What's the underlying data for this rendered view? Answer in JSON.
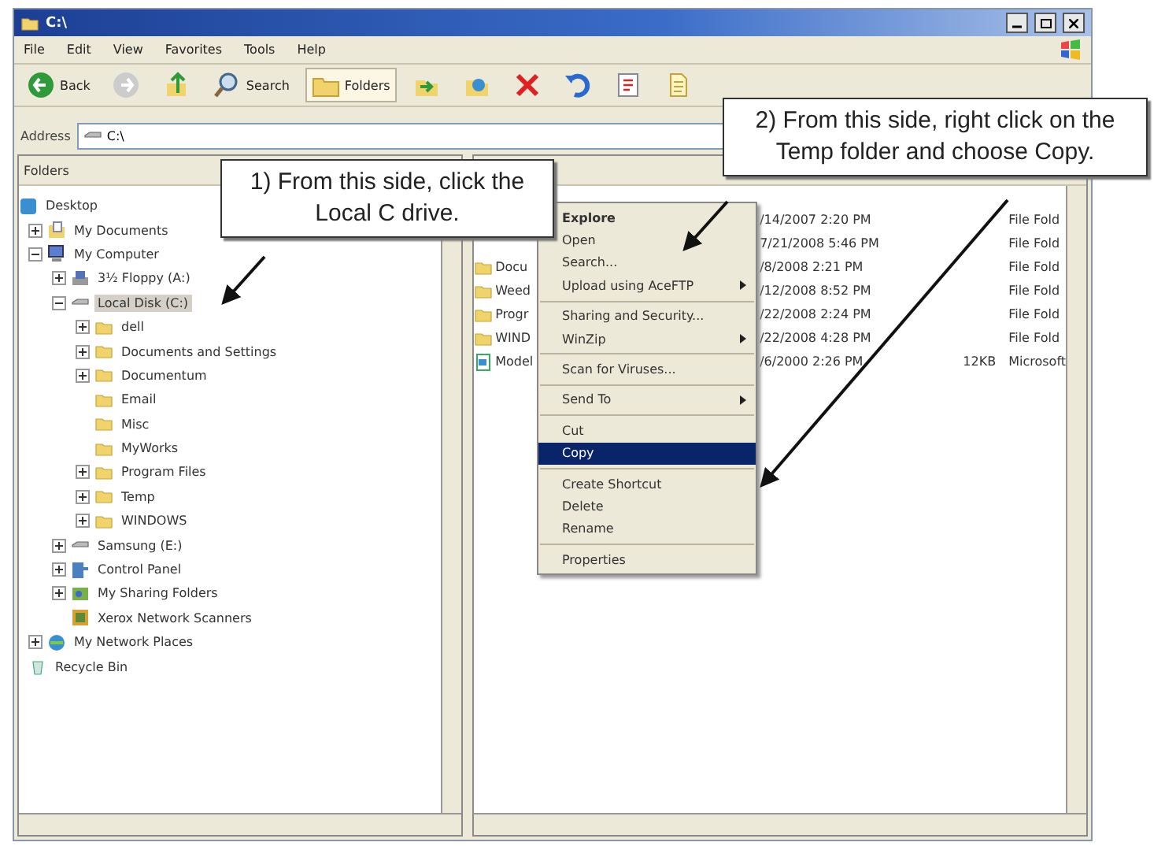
{
  "window": {
    "title": "C:\\"
  },
  "menu_bar": [
    "File",
    "Edit",
    "View",
    "Favorites",
    "Tools",
    "Help"
  ],
  "toolbar": [
    {
      "kind": "back",
      "label": "Back",
      "selected": false
    },
    {
      "kind": "forward",
      "selected": false
    },
    {
      "kind": "up",
      "selected": false
    },
    {
      "kind": "search",
      "label": "Search",
      "selected": false
    },
    {
      "kind": "folders",
      "label": "Folders",
      "selected": true
    },
    {
      "kind": "move",
      "selected": false
    },
    {
      "kind": "copy",
      "selected": false
    },
    {
      "kind": "delete",
      "selected": false
    },
    {
      "kind": "undo",
      "selected": false
    },
    {
      "kind": "properties",
      "selected": false
    },
    {
      "kind": "notes",
      "selected": false
    }
  ],
  "address": {
    "label": "Address",
    "value": "C:\\"
  },
  "folders_pane": {
    "title": "Folders",
    "tree": [
      {
        "label": "Desktop",
        "kind": "desktop",
        "selected": false,
        "children": [
          {
            "label": "My Documents",
            "kind": "documents",
            "expanded": false,
            "selected": false
          },
          {
            "label": "My Computer",
            "kind": "computer",
            "expanded": true,
            "selected": false,
            "children": [
              {
                "label": "3½ Floppy (A:)",
                "kind": "floppy",
                "expanded": false,
                "selected": false
              },
              {
                "label": "Local Disk (C:)",
                "kind": "drive",
                "expanded": true,
                "selected": true,
                "children": [
                  {
                    "label": "dell",
                    "kind": "folder",
                    "expanded": false,
                    "selected": false
                  },
                  {
                    "label": "Documents and Settings",
                    "kind": "folder",
                    "expanded": false,
                    "selected": false
                  },
                  {
                    "label": "Documentum",
                    "kind": "folder",
                    "expanded": false,
                    "selected": false
                  },
                  {
                    "label": "Email",
                    "kind": "folder",
                    "selected": false
                  },
                  {
                    "label": "Misc",
                    "kind": "folder",
                    "selected": false
                  },
                  {
                    "label": "MyWorks",
                    "kind": "folder",
                    "selected": false
                  },
                  {
                    "label": "Program Files",
                    "kind": "folder",
                    "expanded": false,
                    "selected": false
                  },
                  {
                    "label": "Temp",
                    "kind": "folder",
                    "expanded": false,
                    "selected": false
                  },
                  {
                    "label": "WINDOWS",
                    "kind": "folder",
                    "expanded": false,
                    "selected": false
                  }
                ]
              },
              {
                "label": "Samsung (E:)",
                "kind": "drive",
                "expanded": false,
                "selected": false
              },
              {
                "label": "Control Panel",
                "kind": "control",
                "expanded": false,
                "selected": false
              },
              {
                "label": "My Sharing Folders",
                "kind": "sharing",
                "expanded": false,
                "selected": false
              },
              {
                "label": "Xerox Network Scanners",
                "kind": "scanner",
                "selected": false
              }
            ]
          },
          {
            "label": "My Network Places",
            "kind": "network",
            "expanded": false,
            "selected": false
          },
          {
            "label": "Recycle Bin",
            "kind": "recycle",
            "selected": false
          }
        ]
      }
    ]
  },
  "file_list": {
    "rows": [
      {
        "date": "/14/2007 2:20 PM",
        "type": "File Fold"
      },
      {
        "date": "7/21/2008 5:46 PM",
        "type": "File Fold"
      },
      {
        "kind": "folder",
        "name": "Docu",
        "date": "/8/2008 2:21 PM",
        "type": "File Fold"
      },
      {
        "kind": "folder",
        "name": "Weed",
        "date": "/12/2008 8:52 PM",
        "type": "File Fold"
      },
      {
        "kind": "folder",
        "name": "Progr",
        "date": "/22/2008 2:24 PM",
        "type": "File Fold"
      },
      {
        "kind": "folder",
        "name": "WIND",
        "date": "/22/2008 4:28 PM",
        "type": "File Fold"
      },
      {
        "kind": "document",
        "name": "Model",
        "date": "/6/2000 2:26 PM",
        "size": "12KB",
        "type": "Microsoft"
      }
    ]
  },
  "context_menu": [
    {
      "kind": "item",
      "label": "Explore",
      "bold": true,
      "selected": false
    },
    {
      "kind": "item",
      "label": "Open",
      "selected": false
    },
    {
      "kind": "item",
      "label": "Search...",
      "selected": false
    },
    {
      "kind": "submenu",
      "label": "Upload using AceFTP",
      "selected": false
    },
    {
      "kind": "separator"
    },
    {
      "kind": "item",
      "label": "Sharing and Security...",
      "selected": false
    },
    {
      "kind": "submenu",
      "label": "WinZip",
      "selected": false
    },
    {
      "kind": "separator"
    },
    {
      "kind": "item",
      "label": "Scan for Viruses...",
      "selected": false
    },
    {
      "kind": "separator"
    },
    {
      "kind": "submenu",
      "label": "Send To",
      "selected": false
    },
    {
      "kind": "separator"
    },
    {
      "kind": "item",
      "label": "Cut",
      "selected": false
    },
    {
      "kind": "item",
      "label": "Copy",
      "selected": true
    },
    {
      "kind": "separator"
    },
    {
      "kind": "item",
      "label": "Create Shortcut",
      "selected": false
    },
    {
      "kind": "item",
      "label": "Delete",
      "selected": false
    },
    {
      "kind": "item",
      "label": "Rename",
      "selected": false
    },
    {
      "kind": "separator"
    },
    {
      "kind": "item",
      "label": "Properties",
      "selected": false
    }
  ],
  "callouts": [
    {
      "text": "1) From this side, click the Local C drive."
    },
    {
      "text": "2) From this side, right click on the Temp folder and choose Copy."
    }
  ]
}
